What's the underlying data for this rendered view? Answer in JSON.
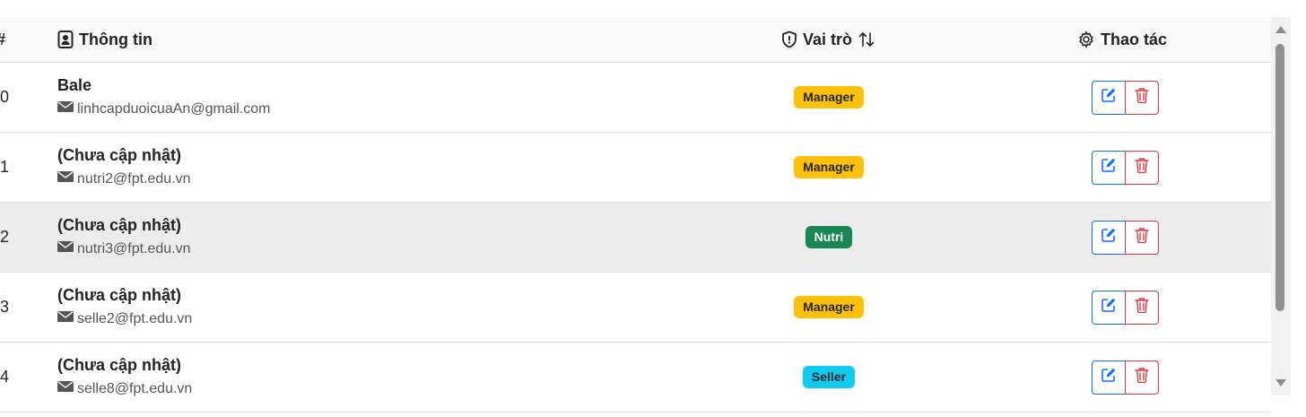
{
  "header": {
    "col_index": "#",
    "col_info": "Thông tin",
    "col_role": "Vai trò",
    "col_actions": "Thao tác",
    "icons": {
      "info": "contact-card-icon",
      "role": "shield-icon",
      "sort": "sort-arrows-icon",
      "actions": "gear-icon"
    }
  },
  "rows": [
    {
      "index": "0",
      "name": "Bale",
      "email": "linhcapduoicuaAn@gmail.com",
      "role": "Manager",
      "role_bg": "#ffc107",
      "role_fg": "#212529"
    },
    {
      "index": "1",
      "name": "(Chưa cập nhật)",
      "email": "nutri2@fpt.edu.vn",
      "role": "Manager",
      "role_bg": "#ffc107",
      "role_fg": "#212529"
    },
    {
      "index": "2",
      "name": "(Chưa cập nhật)",
      "email": "nutri3@fpt.edu.vn",
      "role": "Nutri",
      "role_bg": "#198754",
      "role_fg": "#ffffff"
    },
    {
      "index": "3",
      "name": "(Chưa cập nhật)",
      "email": "selle2@fpt.edu.vn",
      "role": "Manager",
      "role_bg": "#ffc107",
      "role_fg": "#212529"
    },
    {
      "index": "4",
      "name": "(Chưa cập nhật)",
      "email": "selle8@fpt.edu.vn",
      "role": "Seller",
      "role_bg": "#0dcaf0",
      "role_fg": "#212529"
    }
  ],
  "colors": {
    "edit": "#0d6efd",
    "delete": "#dc3545",
    "header_bg": "#f8f9fa",
    "hover_row": "#ececec"
  }
}
